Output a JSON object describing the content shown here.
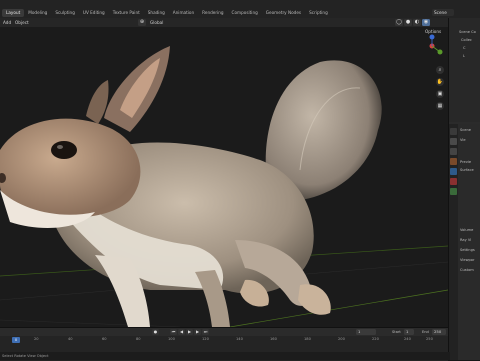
{
  "workspace_tabs": [
    "Layout",
    "Modeling",
    "Sculpting",
    "UV Editing",
    "Texture Paint",
    "Shading",
    "Animation",
    "Rendering",
    "Compositing",
    "Geometry Nodes",
    "Scripting"
  ],
  "active_tab": 0,
  "scene_name": "Scene",
  "viewport_header": {
    "mode_label": "Add",
    "object_label": "Object",
    "transform_orientation": "Global",
    "options_label": "Options"
  },
  "outliner": {
    "title": "Scene Co",
    "items": [
      "Collec",
      "C",
      "L"
    ]
  },
  "properties": {
    "header": "Scene",
    "fields": [
      "Vie",
      "Previe",
      "Surface",
      "Volume",
      "Ray Vi",
      "Settings",
      "Viewpor",
      "Custom"
    ]
  },
  "timeline": {
    "current_frame": "0",
    "start_label": "Start",
    "start_value": "1",
    "end_label": "End",
    "end_value": "250",
    "tick_labels": [
      "20",
      "40",
      "60",
      "80",
      "100",
      "120",
      "140",
      "160",
      "180",
      "200",
      "220",
      "240",
      "250"
    ],
    "playback_field": "1"
  },
  "statusbar": {
    "left_text": "Select  Rotate View  Object"
  },
  "colors": {
    "background": "#161616",
    "accent": "#3f6fb5",
    "fur": "#b8aa9a"
  },
  "icons": [
    "cursor-icon",
    "hand-icon",
    "camera-icon",
    "zoom-icon",
    "grid-icon",
    "render-icon",
    "shield-icon"
  ]
}
